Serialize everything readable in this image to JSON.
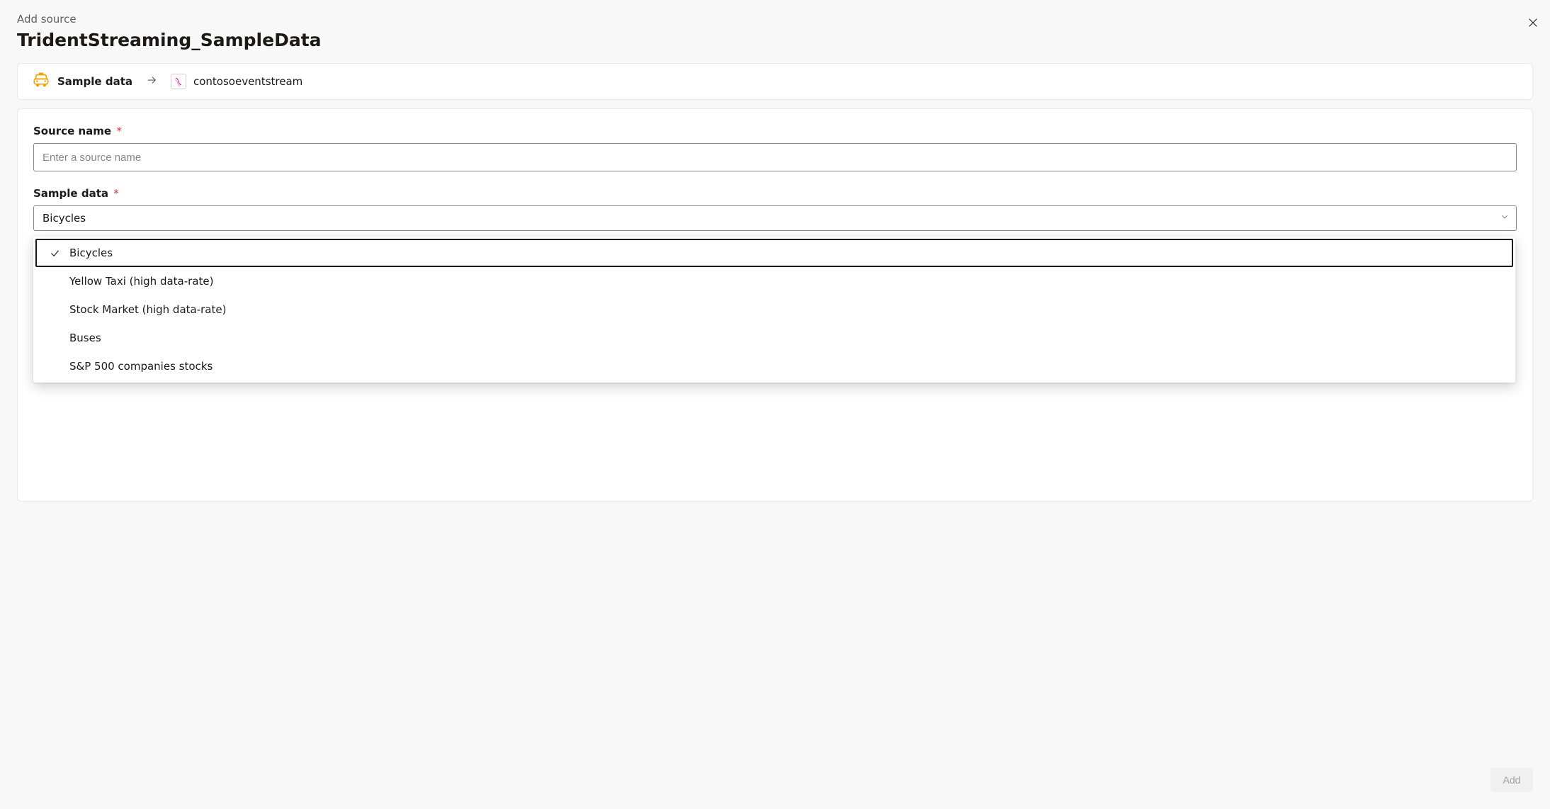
{
  "header": {
    "subtitle": "Add source",
    "title": "TridentStreaming_SampleData"
  },
  "breadcrumb": {
    "source_label": "Sample data",
    "destination_label": "contosoeventstream"
  },
  "form": {
    "source_name": {
      "label": "Source name",
      "required_marker": "*",
      "placeholder": "Enter a source name",
      "value": ""
    },
    "sample_data": {
      "label": "Sample data",
      "required_marker": "*",
      "selected": "Bicycles",
      "options": [
        "Bicycles",
        "Yellow Taxi (high data-rate)",
        "Stock Market (high data-rate)",
        "Buses",
        "S&P 500 companies stocks"
      ]
    }
  },
  "footer": {
    "add_label": "Add"
  }
}
